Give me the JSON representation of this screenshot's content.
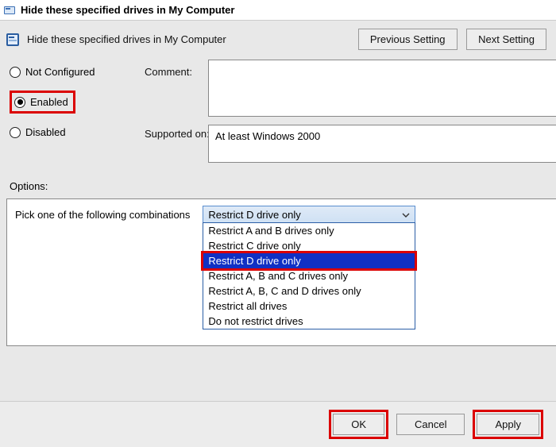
{
  "window": {
    "title": "Hide these specified drives in My Computer"
  },
  "subheader": {
    "title": "Hide these specified drives in My Computer"
  },
  "nav": {
    "prev": "Previous Setting",
    "next": "Next Setting"
  },
  "radios": {
    "not_configured": "Not Configured",
    "enabled": "Enabled",
    "disabled": "Disabled",
    "selected": "enabled"
  },
  "labels": {
    "comment": "Comment:",
    "supported_on": "Supported on:",
    "options": "Options:",
    "pick": "Pick one of the following combinations"
  },
  "supported_text": "At least Windows 2000",
  "dropdown": {
    "selected": "Restrict D drive only",
    "items": [
      "Restrict A and B drives only",
      "Restrict C drive only",
      "Restrict D drive only",
      "Restrict A, B and C drives only",
      "Restrict A, B, C and D drives only",
      "Restrict all drives",
      "Do not restrict drives"
    ]
  },
  "footer": {
    "ok": "OK",
    "cancel": "Cancel",
    "apply": "Apply"
  }
}
